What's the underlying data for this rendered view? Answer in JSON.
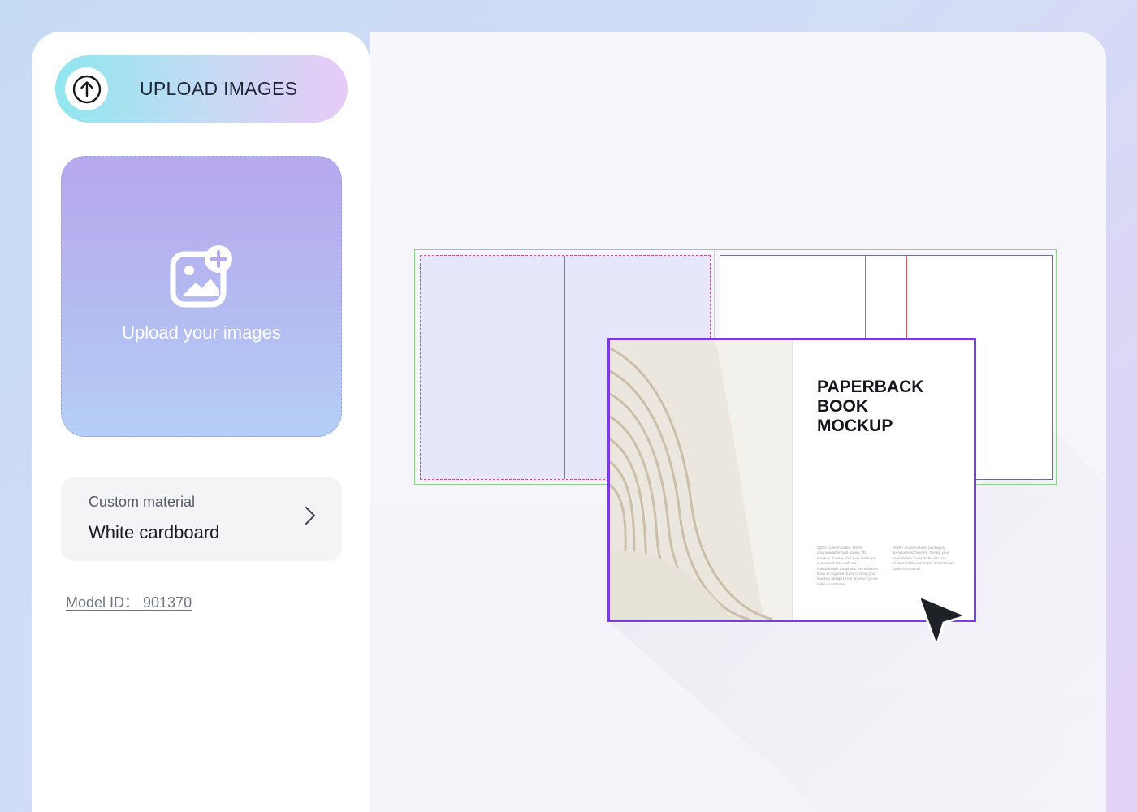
{
  "sidebar": {
    "upload_button": {
      "label": "UPLOAD IMAGES",
      "icon": "arrow-up-circle-icon"
    },
    "dropzone": {
      "text": "Upload your images",
      "icon": "add-image-icon"
    },
    "material": {
      "caption": "Custom material",
      "value": "White cardboard",
      "icon": "chevron-right-icon"
    },
    "model_id": "Model ID： 901370"
  },
  "canvas": {
    "mockup": {
      "title_lines": [
        "PAPERBACK",
        "BOOK",
        "MOCKUP"
      ],
      "fine_print_left": "100% Customizable, 100% downloadable high-quality 3D mockup. Create your own mockups in seconds free with our customizable templates. No software Book is required. Easy to bring your mockup design to life, trusted by one million customers.",
      "fine_print_right": "2000+ Customizable packaging templates & Dielines. Create your own dieline in seconds with our customizable templates. No software base is required."
    },
    "cursor_icon": "pointer-cursor-icon"
  },
  "colors": {
    "selection": "#7a3be0",
    "bleed_line": "#c84e8c",
    "fold_line": "#e15a5a",
    "trim_line": "#8fd08a"
  }
}
